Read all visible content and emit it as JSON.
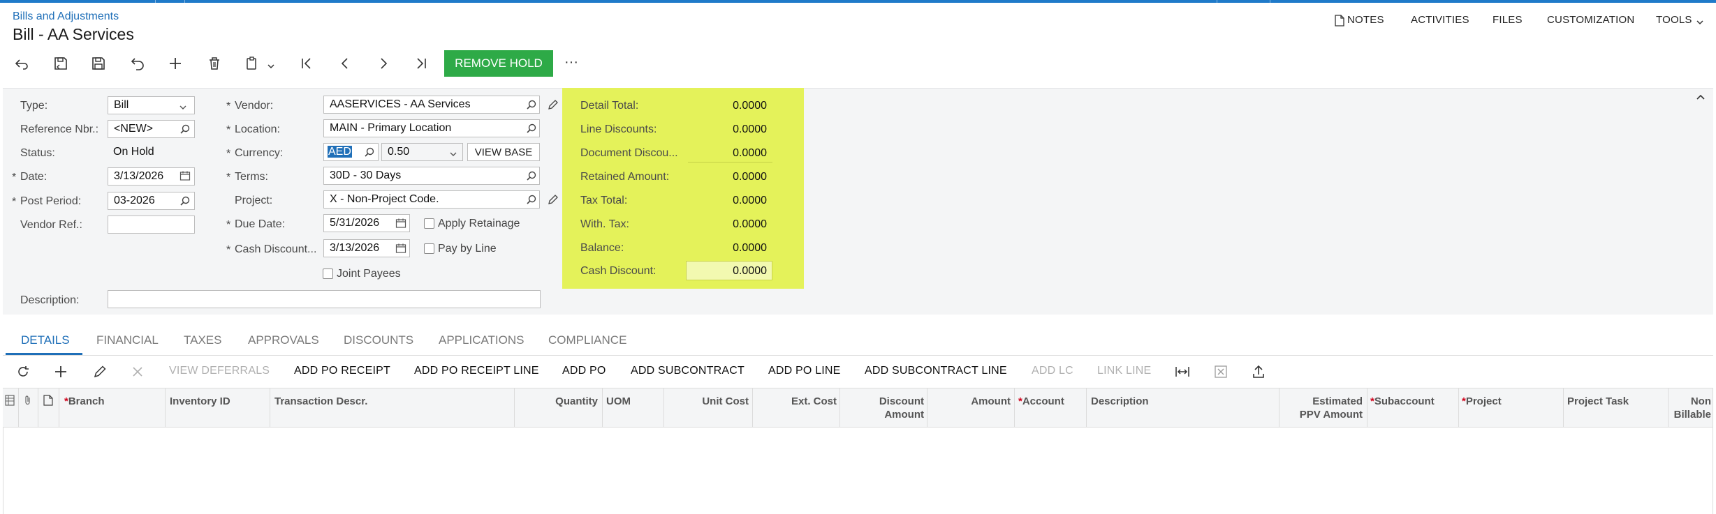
{
  "breadcrumb": "Bills and Adjustments",
  "title": "Bill - AA Services",
  "top_links": [
    "NOTES",
    "ACTIVITIES",
    "FILES",
    "CUSTOMIZATION",
    "TOOLS"
  ],
  "toolbar": {
    "remove_hold": "REMOVE HOLD",
    "more": "···"
  },
  "form": {
    "type": {
      "label": "Type:",
      "value": "Bill"
    },
    "reference": {
      "label": "Reference Nbr.:",
      "value": "<NEW>"
    },
    "status": {
      "label": "Status:",
      "value": "On Hold"
    },
    "date": {
      "label": "Date:",
      "value": "3/13/2026"
    },
    "post_period": {
      "label": "Post Period:",
      "value": "03-2026"
    },
    "vendor_ref": {
      "label": "Vendor Ref.:",
      "value": ""
    },
    "vendor": {
      "label": "Vendor:",
      "value": "AASERVICES - AA Services"
    },
    "location": {
      "label": "Location:",
      "value": "MAIN - Primary Location"
    },
    "currency": {
      "label": "Currency:",
      "value": "AED",
      "rate": "0.50",
      "view_base": "VIEW BASE"
    },
    "terms": {
      "label": "Terms:",
      "value": "30D - 30 Days"
    },
    "project": {
      "label": "Project:",
      "value": "X - Non-Project Code."
    },
    "due_date": {
      "label": "Due Date:",
      "value": "5/31/2026"
    },
    "cash_discount_date": {
      "label": "Cash Discount...",
      "value": "3/13/2026"
    },
    "apply_retainage": "Apply Retainage",
    "pay_by_line": "Pay by Line",
    "joint_payees": "Joint Payees",
    "description": {
      "label": "Description:",
      "value": ""
    }
  },
  "totals": [
    {
      "label": "Detail Total:",
      "value": "0.0000"
    },
    {
      "label": "Line Discounts:",
      "value": "0.0000"
    },
    {
      "label": "Document Discou...",
      "value": "0.0000"
    },
    {
      "label": "Retained Amount:",
      "value": "0.0000"
    },
    {
      "label": "Tax Total:",
      "value": "0.0000"
    },
    {
      "label": "With. Tax:",
      "value": "0.0000"
    },
    {
      "label": "Balance:",
      "value": "0.0000"
    },
    {
      "label": "Cash Discount:",
      "value": "0.0000"
    }
  ],
  "tabs": [
    "DETAILS",
    "FINANCIAL",
    "TAXES",
    "APPROVALS",
    "DISCOUNTS",
    "APPLICATIONS",
    "COMPLIANCE"
  ],
  "grid_toolbar": {
    "view_deferrals": "VIEW DEFERRALS",
    "add_po_receipt": "ADD PO RECEIPT",
    "add_po_receipt_line": "ADD PO RECEIPT LINE",
    "add_po": "ADD PO",
    "add_subcontract": "ADD SUBCONTRACT",
    "add_po_line": "ADD PO LINE",
    "add_subcontract_line": "ADD SUBCONTRACT LINE",
    "add_lc": "ADD LC",
    "link_line": "LINK LINE"
  },
  "columns": {
    "branch": "Branch",
    "inventory_id": "Inventory ID",
    "transaction_descr": "Transaction Descr.",
    "quantity": "Quantity",
    "uom": "UOM",
    "unit_cost": "Unit Cost",
    "ext_cost": "Ext. Cost",
    "discount_amount_1": "Discount",
    "discount_amount_2": "Amount",
    "amount": "Amount",
    "account": "Account",
    "description": "Description",
    "estimated_ppv_1": "Estimated",
    "estimated_ppv_2": "PPV Amount",
    "subaccount": "Subaccount",
    "project": "Project",
    "project_task": "Project Task",
    "non_billable_1": "Non",
    "non_billable_2": "Billable"
  },
  "required_star": "*",
  "colors": {
    "accent": "#1f6fb8",
    "remove_hold": "#2eaa47",
    "totals_bg": "#e4f25a"
  }
}
